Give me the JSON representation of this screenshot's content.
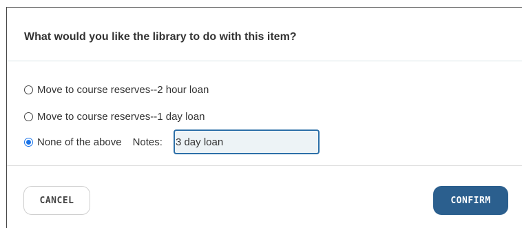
{
  "dialog": {
    "title": "What would you like the library to do with this item?",
    "options": [
      {
        "label": "Move to course reserves--2 hour loan",
        "selected": false
      },
      {
        "label": "Move to course reserves--1 day loan",
        "selected": false
      },
      {
        "label": "None of the above",
        "selected": true
      }
    ],
    "notes": {
      "label": "Notes:",
      "value": "3 day loan"
    },
    "buttons": {
      "cancel": "CANCEL",
      "confirm": "CONFIRM"
    },
    "colors": {
      "confirm_bg": "#2b5f8e",
      "radio_selected": "#1a73e8",
      "input_border": "#2c6fa8",
      "input_bg": "#edf3f6"
    }
  }
}
